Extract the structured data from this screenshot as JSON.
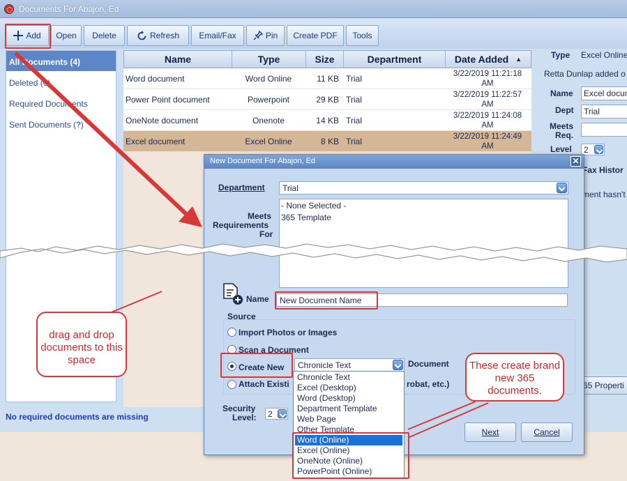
{
  "window": {
    "title": "Documents For Abajon, Ed"
  },
  "toolbar": {
    "add": "Add",
    "open": "Open",
    "delete": "Delete",
    "refresh": "Refresh",
    "email_fax": "Email/Fax",
    "pin": "Pin",
    "create_pdf": "Create PDF",
    "tools": "Tools"
  },
  "sidebar": {
    "items": [
      "All Documents (4)",
      "Deleted (0)",
      "Required Documents",
      "Sent Documents (?)"
    ],
    "status": "No required documents are missing"
  },
  "table": {
    "headers": [
      "Name",
      "Type",
      "Size",
      "Department",
      "Date Added"
    ],
    "sort_indicator": "▲",
    "rows": [
      {
        "name": "Word document",
        "type": "Word Online",
        "size": "11 KB",
        "department": "Trial",
        "date": "3/22/2019 11:21:18",
        "ampm": "AM"
      },
      {
        "name": "Power Point document",
        "type": "Powerpoint",
        "size": "29 KB",
        "department": "Trial",
        "date": "3/22/2019 11:22:57",
        "ampm": "AM"
      },
      {
        "name": "OneNote document",
        "type": "Onenote",
        "size": "14 KB",
        "department": "Trial",
        "date": "3/22/2019 11:24:08",
        "ampm": "AM"
      },
      {
        "name": "Excel document",
        "type": "Excel Online",
        "size": "8 KB",
        "department": "Trial",
        "date": "3/22/2019 11:24:49",
        "ampm": "AM"
      }
    ]
  },
  "details": {
    "type_label": "Type",
    "type_value": "Excel Online",
    "added_by": "Retta Dunlap added o",
    "name_label": "Name",
    "name_value": "Excel docum",
    "dept_label": "Dept",
    "dept_value": "Trial",
    "meets_label": "Meets",
    "req_label": "Req.",
    "level_label": "Level",
    "level_value": "2",
    "fax_history": "Fax Histor",
    "fax_msg": "ment hasn't",
    "properties": "65 Properti"
  },
  "dialog": {
    "title": "New Document For Abajon, Ed",
    "department_label": "Department",
    "department_value": "Trial",
    "meets_label_1": "Meets",
    "meets_label_2": "Requirements",
    "meets_label_3": "For",
    "meets_options": [
      "- None Selected -",
      "365 Template"
    ],
    "name_label": "Name",
    "name_value": "New Document Name",
    "source_label": "Source",
    "options": {
      "import": "Import Photos or Images",
      "scan": "Scan a Document",
      "create": "Create New",
      "attach": "Attach Existi",
      "attach_tail": "robat, etc.)"
    },
    "document_word": "Document",
    "create_selected": "Chronicle Text",
    "create_options": [
      "Chronicle Text",
      "Excel (Desktop)",
      "Word (Desktop)",
      "Department Template",
      "Web Page",
      "Other Template",
      "Word (Online)",
      "Excel (Online)",
      "OneNote (Online)",
      "PowerPoint (Online)"
    ],
    "security_label_1": "Security",
    "security_label_2": "Level:",
    "security_value": "2",
    "next": "Next",
    "cancel": "Cancel"
  },
  "annotations": {
    "drag_drop": "drag and drop documents to this space",
    "create_365": "These create brand new 365 documents."
  },
  "colors": {
    "annotation_red": "#d9383a",
    "selected_row": "#d4b796",
    "header_blue": "#5c86c8"
  }
}
